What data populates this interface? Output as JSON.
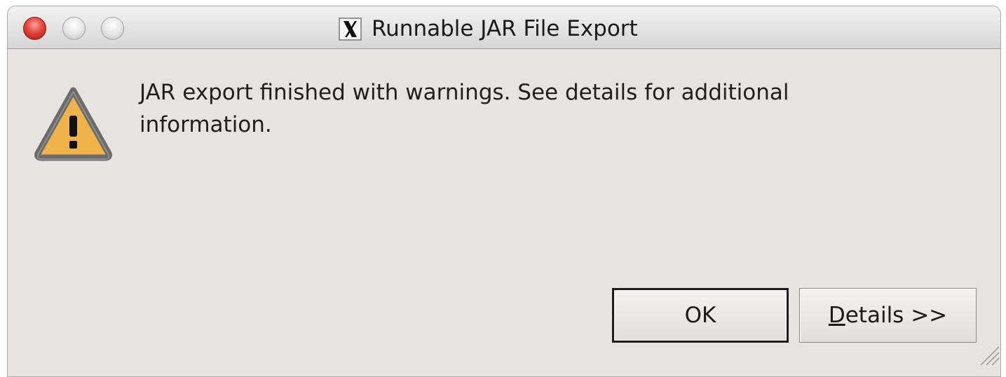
{
  "window": {
    "title": "Runnable JAR File Export"
  },
  "dialog": {
    "icon": "warning-icon",
    "message": "JAR export finished with warnings. See details for additional information."
  },
  "buttons": {
    "ok_label": "OK",
    "details_mnemonic": "D",
    "details_rest": "etails >>"
  },
  "colors": {
    "window_bg": "#e6e4e1",
    "close_button": "#e3453d",
    "warning_fill": "#f0b24a",
    "warning_border": "#6b6b6b"
  }
}
